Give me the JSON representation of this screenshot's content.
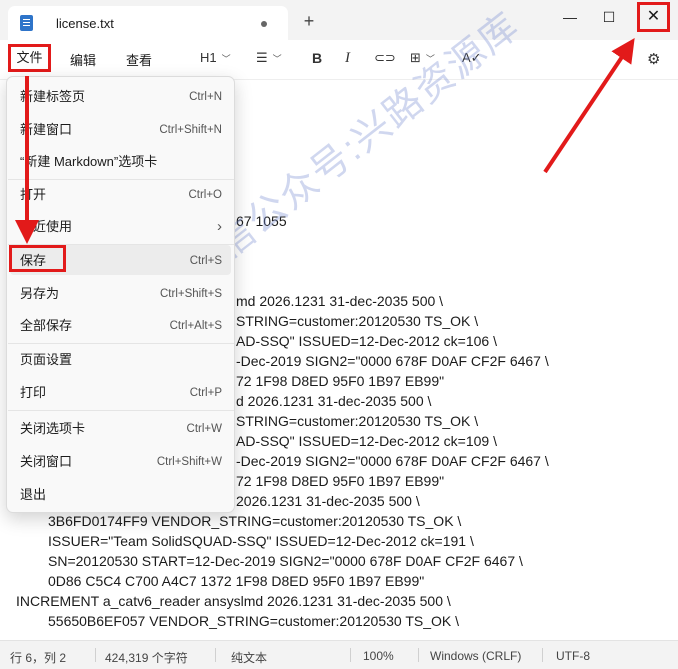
{
  "tab": {
    "title": "license.txt",
    "new_tab": "+"
  },
  "window": {
    "minimize": "—",
    "maximize": "☐",
    "close": "✕"
  },
  "menubar": {
    "file": "文件",
    "edit": "编辑",
    "view": "查看"
  },
  "toolbar": {
    "heading": "H1",
    "bold": "B",
    "italic": "I"
  },
  "menu_items": [
    {
      "label": "新建标签页",
      "shortcut": "Ctrl+N"
    },
    {
      "label": "新建窗口",
      "shortcut": "Ctrl+Shift+N"
    },
    {
      "label": "“新建 Markdown”选项卡",
      "shortcut": ""
    },
    {
      "label": "打开",
      "shortcut": "Ctrl+O"
    },
    {
      "label": "最近使用",
      "shortcut": "›"
    },
    {
      "label": "保存",
      "shortcut": "Ctrl+S"
    },
    {
      "label": "另存为",
      "shortcut": "Ctrl+Shift+S"
    },
    {
      "label": "全部保存",
      "shortcut": "Ctrl+Alt+S"
    },
    {
      "label": "页面设置",
      "shortcut": ""
    },
    {
      "label": "打印",
      "shortcut": "Ctrl+P"
    },
    {
      "label": "关闭选项卡",
      "shortcut": "Ctrl+W"
    },
    {
      "label": "关闭窗口",
      "shortcut": "Ctrl+Shift+W"
    },
    {
      "label": "退出",
      "shortcut": ""
    }
  ],
  "editor_lines": [
    "67 1055",
    "md 2026.1231 31-dec-2035 500 \\",
    "STRING=customer:20120530 TS_OK \\",
    "AD-SSQ\" ISSUED=12-Dec-2012 ck=106 \\",
    "-Dec-2019 SIGN2=\"0000 678F D0AF CF2F 6467 \\",
    "72 1F98 D8ED 95F0 1B97 EB99\"",
    "d 2026.1231 31-dec-2035 500 \\",
    "STRING=customer:20120530 TS_OK \\",
    "AD-SSQ\" ISSUED=12-Dec-2012 ck=109 \\",
    "-Dec-2019 SIGN2=\"0000 678F D0AF CF2F 6467 \\",
    "72 1F98 D8ED 95F0 1B97 EB99\"",
    "2026.1231 31-dec-2035 500 \\",
    "3B6FD0174FF9 VENDOR_STRING=customer:20120530 TS_OK \\",
    "ISSUER=\"Team SolidSQUAD-SSQ\" ISSUED=12-Dec-2012 ck=191 \\",
    "SN=20120530 START=12-Dec-2019 SIGN2=\"0000 678F D0AF CF2F 6467 \\",
    "0D86 C5C4 C700 A4C7 1372 1F98 D8ED 95F0 1B97 EB99\"",
    "INCREMENT a_catv6_reader ansyslmd 2026.1231 31-dec-2035 500 \\",
    "55650B6EF057 VENDOR_STRING=customer:20120530 TS_OK \\"
  ],
  "status": {
    "position": "行 6，列 2",
    "chars": "424,319 个字符",
    "format": "纯文本",
    "zoom": "100%",
    "eol": "Windows (CRLF)",
    "encoding": "UTF-8"
  },
  "watermark": "微信公众号:兴路资源库",
  "colors": {
    "annotation": "#e21a1a"
  }
}
